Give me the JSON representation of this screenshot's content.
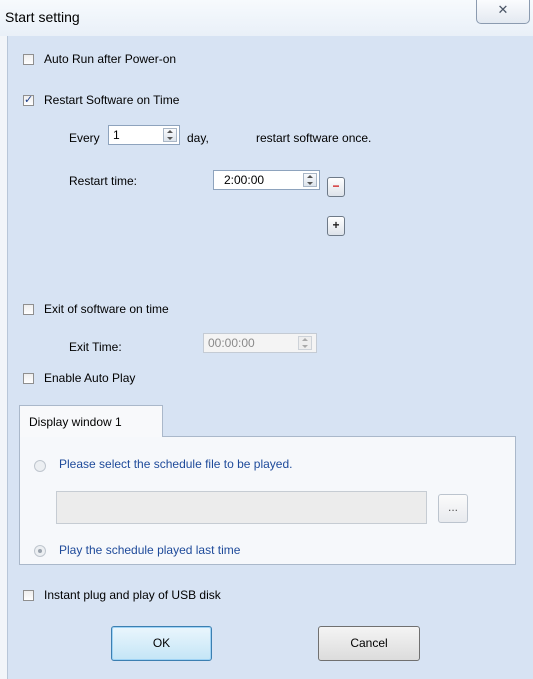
{
  "window": {
    "title": "Start setting",
    "close_glyph": "✕"
  },
  "auto_run": {
    "label": "Auto Run after Power-on",
    "checked": false
  },
  "restart": {
    "label": "Restart Software on Time",
    "checked": true,
    "every_label": "Every",
    "days_value": "1",
    "day_unit": "day,",
    "once_label": "restart software once.",
    "time_label": "Restart time:",
    "time_value": "2:00:00",
    "remove_glyph": "−",
    "add_glyph": "+"
  },
  "exit": {
    "label": "Exit of software on time",
    "checked": false,
    "time_label": "Exit Time:",
    "time_value": "00:00:00"
  },
  "auto_play": {
    "label": "Enable Auto Play",
    "checked": false
  },
  "display": {
    "tab_label": "Display window 1",
    "option_select": "Please select the schedule file to be played.",
    "schedule_path": "",
    "browse_label": "...",
    "option_last": "Play the schedule played last time"
  },
  "usb": {
    "label": "Instant plug and play of USB disk",
    "checked": false
  },
  "buttons": {
    "ok": "OK",
    "cancel": "Cancel"
  }
}
